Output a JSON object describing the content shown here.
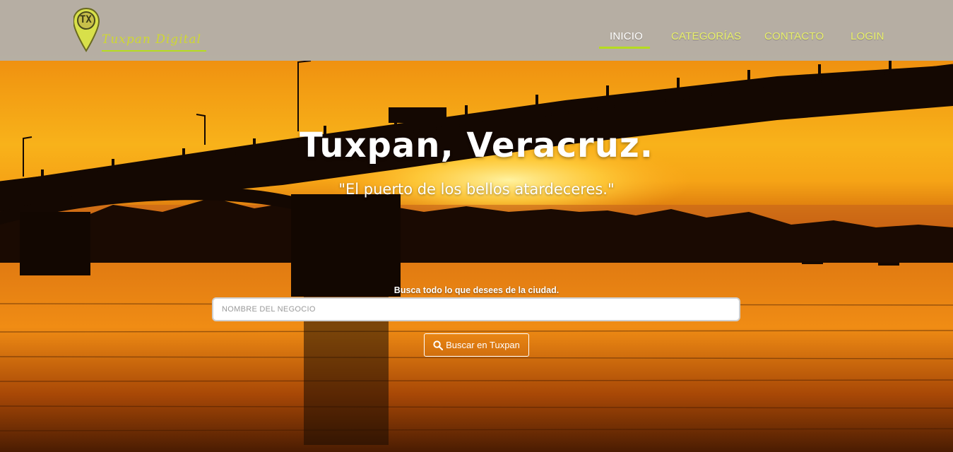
{
  "brand": {
    "logo_initials": "TX",
    "name": "Tuxpan Digital",
    "accent_color": "#b6dc1e"
  },
  "nav": {
    "items": [
      {
        "label": "INICIO",
        "active": true
      },
      {
        "label": "CATEGORÍAS",
        "active": false
      },
      {
        "label": "CONTACTO",
        "active": false
      },
      {
        "label": "LOGIN",
        "active": false
      }
    ]
  },
  "hero": {
    "title": "Tuxpan, Veracruz.",
    "subtitle": "\"El puerto de los bellos atardeceres.\""
  },
  "search": {
    "label": "Busca todo lo que desees de la ciudad.",
    "placeholder": "NOMBRE DEL NEGOCIO",
    "value": "",
    "button_label": "Buscar en Tuxpan",
    "button_icon": "search-icon"
  }
}
